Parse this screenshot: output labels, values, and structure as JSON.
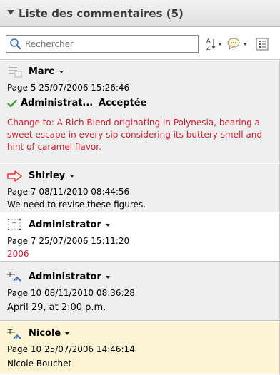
{
  "header": {
    "title": "Liste des commentaires (5)"
  },
  "search": {
    "placeholder": "Rechercher"
  },
  "toolbar": {
    "sort_icon": "sort-az-icon",
    "filter_icon": "comment-filter-icon",
    "options_icon": "list-options-icon"
  },
  "comments": [
    {
      "author": "Marc",
      "page_date": "Page 5  25/07/2006 15:26:46",
      "status_author": "Administrat...",
      "status": "Acceptée",
      "text": "Change to: A Rich Blend originating in Polynesia, bearing a sweet escape in every sip considering its buttery smell and hint of caramel flavor."
    },
    {
      "author": "Shirley",
      "page_date": "Page 7  08/11/2010 08:44:56",
      "text": "We need to revise these figures."
    },
    {
      "author": "Administrator",
      "page_date": "Page 7  25/07/2006 15:11:20",
      "text": "2006"
    },
    {
      "author": "Administrator",
      "page_date": "Page 10  08/11/2010 08:36:28",
      "text": "April 29, at 2:00 p.m."
    },
    {
      "author": "Nicole",
      "page_date": "Page 10  25/07/2006 14:46:14",
      "text": "Nicole Bouchet"
    }
  ],
  "colors": {
    "selected_bg": "#fdf5d3",
    "alt_bg": "#efefef",
    "red_text": "#d0202e",
    "arrow_red": "#e8362f",
    "check_green": "#3aa335"
  }
}
